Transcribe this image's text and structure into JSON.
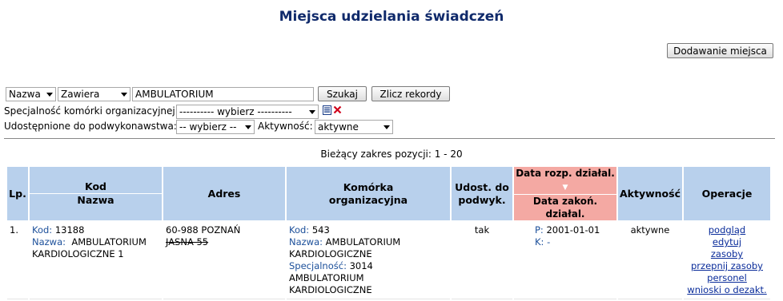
{
  "page": {
    "title": "Miejsca udzielania świadczeń"
  },
  "toolbar": {
    "add_button": "Dodawanie miejsca"
  },
  "filters": {
    "field_select": "Nazwa",
    "mode_select": "Zawiera",
    "query_value": "AMBULATORIUM",
    "search_button": "Szukaj",
    "count_button": "Zlicz rekordy",
    "specialty_label": "Specjalność komórki organizacyjnej:",
    "specialty_select": "---------- wybierz ----------",
    "subcontract_label": "Udostępnione do podwykonawstwa:",
    "subcontract_select": "-- wybierz --",
    "activity_label": "Aktywność:",
    "activity_select": "aktywne"
  },
  "results": {
    "range_text": "Bieżący zakres pozycji: 1 - 20"
  },
  "table": {
    "headers": {
      "lp": "Lp.",
      "kod": "Kod",
      "nazwa": "Nazwa",
      "adres": "Adres",
      "komorka_1": "Komórka",
      "komorka_2": "organizacyjna",
      "udost_1": "Udost. do",
      "udost_2": "podwyk.",
      "data_rozp": "Data rozp. działal.",
      "data_zakon": "Data zakoń. działal.",
      "aktywnosc": "Aktywność",
      "operacje": "Operacje"
    },
    "rows": [
      {
        "lp": "1.",
        "kod_label": "Kod:",
        "kod": "13188",
        "nazwa_label": "Nazwa:",
        "nazwa": "AMBULATORIUM KARDIOLOGICZNE 1",
        "adres_1": "60-988 POZNAŃ",
        "adres_2": "JASNA 55",
        "kom_kod_label": "Kod:",
        "kom_kod": "543",
        "kom_nazwa_label": "Nazwa:",
        "kom_nazwa": "AMBULATORIUM KARDIOLOGICZNE",
        "spec_label": "Specjalność:",
        "spec_kod": "3014",
        "spec_nazwa": "AMBULATORIUM KARDIOLOGICZNE",
        "udost": "tak",
        "p_label": "P:",
        "p_date": "2001-01-01",
        "k_label": "K:",
        "k_date": "-",
        "aktywnosc": "aktywne",
        "ops": [
          "podgląd",
          "edytuj",
          "zasoby",
          "przepnij zasoby",
          "personel",
          "wnioski o dezakt."
        ]
      }
    ]
  },
  "icons": {
    "list_icon": "list-icon",
    "clear_icon": "clear-x-icon",
    "sort_icon": "sort-desc-icon"
  },
  "colors": {
    "title": "#102a6b",
    "header_bg": "#b8d0ec",
    "sorted_header_bg": "#f4a9a3",
    "link": "#0a2c9a",
    "clear_x": "#d0021b"
  }
}
